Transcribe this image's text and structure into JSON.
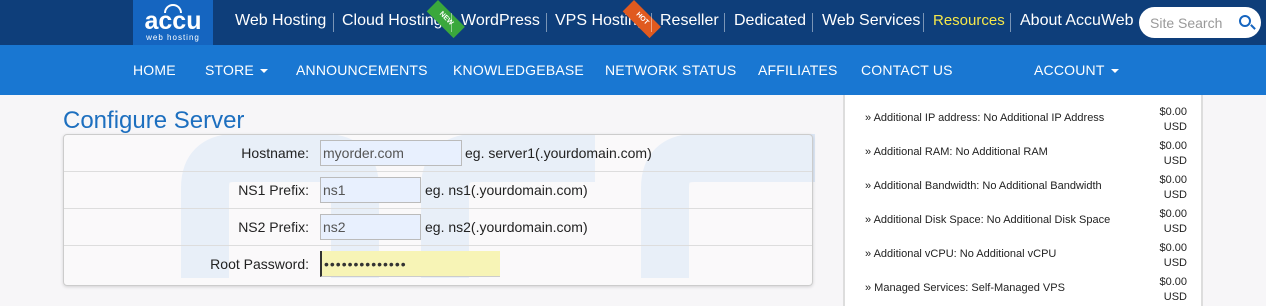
{
  "brand": {
    "logo_text": "accu",
    "logo_sub": "web hosting"
  },
  "topnav": {
    "items": [
      {
        "label": "Web Hosting"
      },
      {
        "label": "Cloud Hosting",
        "ribbon": "NEW"
      },
      {
        "label": "WordPress"
      },
      {
        "label": "VPS Hosting",
        "ribbon": "HOT"
      },
      {
        "label": "Reseller"
      },
      {
        "label": "Dedicated"
      },
      {
        "label": "Web Services"
      },
      {
        "label": "Resources",
        "active": true
      },
      {
        "label": "About AccuWeb"
      }
    ],
    "search_placeholder": "Site Search"
  },
  "mainnav": {
    "items": [
      "HOME",
      "STORE",
      "ANNOUNCEMENTS",
      "KNOWLEDGEBASE",
      "NETWORK STATUS",
      "AFFILIATES",
      "CONTACT US",
      "ACCOUNT"
    ]
  },
  "page": {
    "title": "Configure Server"
  },
  "form": {
    "hostname": {
      "label": "Hostname:",
      "value": "myorder.com",
      "hint": "eg. server1(.yourdomain.com)"
    },
    "ns1": {
      "label": "NS1 Prefix:",
      "value": "ns1",
      "hint": "eg. ns1(.yourdomain.com)"
    },
    "ns2": {
      "label": "NS2 Prefix:",
      "value": "ns2",
      "hint": "eg. ns2(.yourdomain.com)"
    },
    "root_password": {
      "label": "Root Password:",
      "value": "••••••••••••••"
    }
  },
  "sidebar": {
    "items": [
      {
        "label": "» Additional IP address: No Additional IP Address",
        "price": "$0.00",
        "currency": "USD"
      },
      {
        "label": "» Additional RAM: No Additional RAM",
        "price": "$0.00",
        "currency": "USD"
      },
      {
        "label": "» Additional Bandwidth: No Additional Bandwidth",
        "price": "$0.00",
        "currency": "USD"
      },
      {
        "label": "» Additional Disk Space: No Additional Disk Space",
        "price": "$0.00",
        "currency": "USD"
      },
      {
        "label": "» Additional vCPU: No Additional vCPU",
        "price": "$0.00",
        "currency": "USD"
      },
      {
        "label": "» Managed Services: Self-Managed VPS",
        "price": "$0.00",
        "currency": "USD"
      }
    ]
  },
  "colors": {
    "topbar": "#0e3e7a",
    "mainnav": "#1977d2",
    "accent": "#f5e74a",
    "title": "#1d6fbf"
  }
}
